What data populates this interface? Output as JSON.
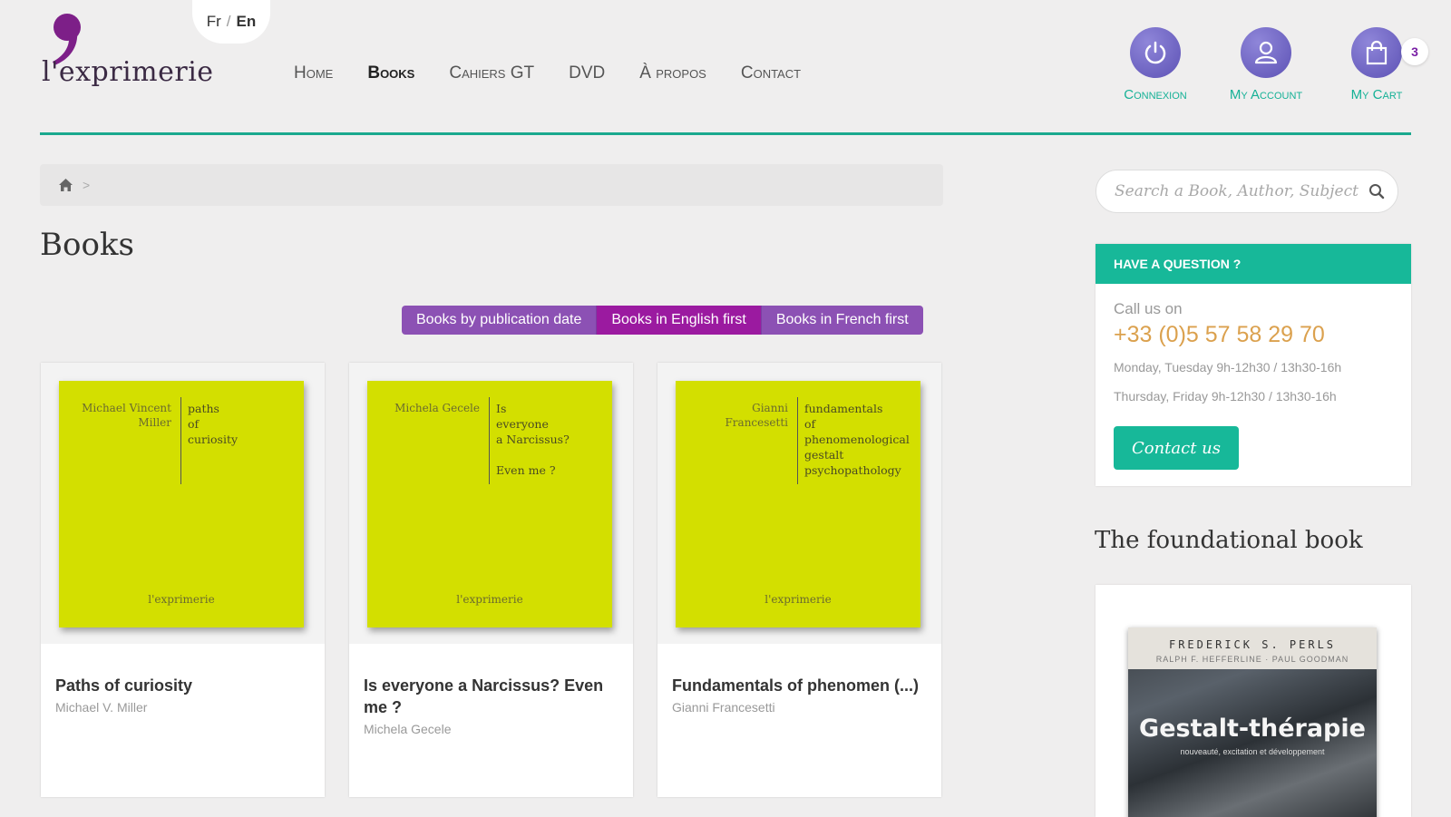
{
  "brand": {
    "logo_text": "l'exprimerie"
  },
  "language": {
    "fr": "Fr",
    "separator": "/",
    "en": "En"
  },
  "nav": [
    {
      "label": "Home"
    },
    {
      "label": "Books"
    },
    {
      "label": "Cahiers GT"
    },
    {
      "label": "DVD"
    },
    {
      "label": "À propos"
    },
    {
      "label": "Contact"
    }
  ],
  "user": {
    "connexion": "Connexion",
    "account": "My Account",
    "cart": "My Cart",
    "cart_count": "3"
  },
  "breadcrumb": {
    "separator": ">"
  },
  "page_title": "Books",
  "sort_tabs": [
    {
      "label": "Books by publication date"
    },
    {
      "label": "Books in English first"
    },
    {
      "label": "Books in French first"
    }
  ],
  "books": [
    {
      "title": "Paths of curiosity",
      "author": "Michael V. Miller",
      "cover_author": "Michael Vincent Miller",
      "cover_title": "paths\nof\ncuriosity",
      "cover_publisher": "l'exprimerie"
    },
    {
      "title": "Is everyone a Narcissus? Even me ?",
      "author": "Michela Gecele",
      "cover_author": "Michela Gecele",
      "cover_title": "Is\neveryone\na Narcissus?\n\nEven me ?",
      "cover_publisher": "l'exprimerie"
    },
    {
      "title": "Fundamentals of phenomen (...)",
      "author": "Gianni Francesetti",
      "cover_author": "Gianni Francesetti",
      "cover_title": "fundamentals\nof\nphenomenological\ngestalt\npsychopathology",
      "cover_publisher": "l'exprimerie"
    }
  ],
  "search": {
    "placeholder": "Search a Book, Author, Subject"
  },
  "question": {
    "heading": "HAVE A QUESTION ?",
    "call_us": "Call us on",
    "phone": "+33 (0)5 57 58 29 70",
    "hours_1": "Monday, Tuesday 9h-12h30 / 13h30-16h",
    "hours_2": "Thursday, Friday 9h-12h30 / 13h30-16h",
    "button": "Contact us"
  },
  "foundational": {
    "heading": "The foundational book",
    "cover_author": "FREDERICK S. PERLS",
    "cover_coauthors": "RALPH F. HEFFERLINE · PAUL GOODMAN",
    "cover_title": "Gestalt-thérapie",
    "cover_subtitle": "nouveauté, excitation et développement"
  },
  "colors": {
    "accent_green": "#17b899",
    "tab_purple": "#8c51b4",
    "tab_selected": "#9b1aa0",
    "phone_gold": "#dba14e",
    "cover_yellow": "#d3df00"
  }
}
